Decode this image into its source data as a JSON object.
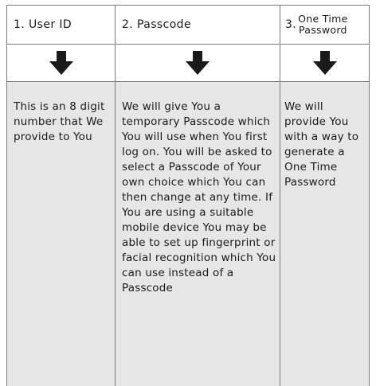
{
  "columns": [
    {
      "number": "1.",
      "title": "User ID",
      "body": "This is an 8 digit number that We provide to You"
    },
    {
      "number": "2.",
      "title": "Passcode",
      "body": "We will give You a temporary Passcode which You will use when You first log on. You will be asked to select a Passcode of Your own choice which You can then change at any time. If You are using a suitable mobile device You may be able to set up fingerprint or facial recognition which You can use instead of a Passcode"
    },
    {
      "number": "3.",
      "title_line1": "One Time",
      "title_line2": "Password",
      "body": "We will provide You with a way to generate a One Time Password"
    }
  ],
  "icons": {
    "arrow": "arrow-down-icon"
  },
  "colors": {
    "body_background": "#e6e6e6",
    "border": "#7a7a7a",
    "arrow": "#1a1a1a"
  }
}
